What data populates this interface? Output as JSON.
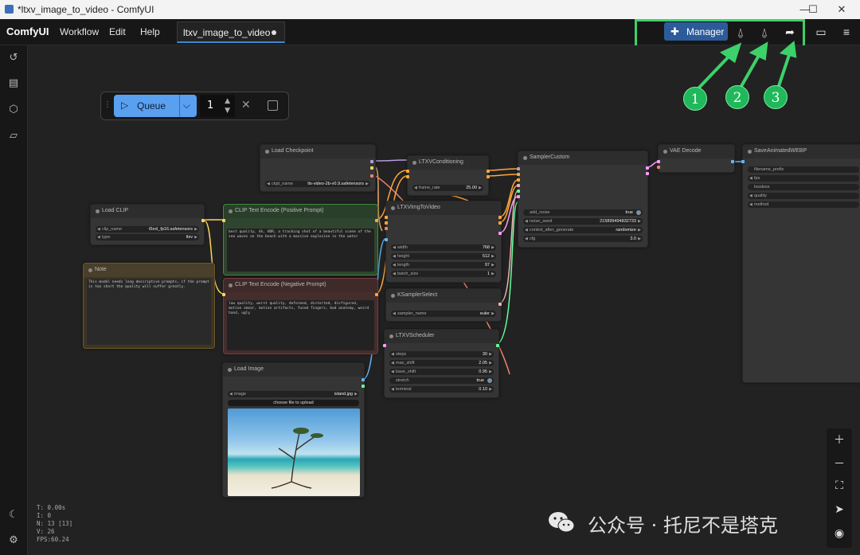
{
  "window": {
    "title": "*ltxv_image_to_video - ComfyUI",
    "min": "—",
    "max": "☐",
    "close": "✕"
  },
  "menubar": {
    "brand": "ComfyUI",
    "items": [
      "Workflow",
      "Edit",
      "Help"
    ],
    "tab": "ltxv_image_to_video",
    "manager": "Manager"
  },
  "queue": {
    "label": "Queue",
    "count": "1"
  },
  "nodes": {
    "load_checkpoint": {
      "title": "Load Checkpoint",
      "w_ckpt": "ckpt_name",
      "v_ckpt": "ltx-video-2b-v0.9.safetensors"
    },
    "ltxv_cond": {
      "title": "LTXVConditioning",
      "w_fr": "frame_rate",
      "v_fr": "25.00"
    },
    "sampler_custom": {
      "title": "SamplerCustom",
      "w1": "add_noise",
      "v1": "true",
      "w2": "noise_seed",
      "v2": "215899494832733",
      "w3": "control_after_generate",
      "v3": "randomize",
      "w4": "cfg",
      "v4": "3.0"
    },
    "vae_decode": {
      "title": "VAE Decode"
    },
    "save_webp": {
      "title": "SaveAnimatedWEBP",
      "w1": "filename_prefix",
      "w2": "fps",
      "w3": "lossless",
      "w4": "quality",
      "w5": "method"
    },
    "load_clip": {
      "title": "Load CLIP",
      "w1": "clip_name",
      "v1": "t5xxl_fp16.safetensors",
      "w2": "type",
      "v2": "ltxv"
    },
    "clip_pos": {
      "title": "CLIP Text Encode (Positive Prompt)",
      "text": "best quality, 4k, HDR, a tracking shot of a beautiful scene of the sea waves on the beach with a massive explosion in the water"
    },
    "clip_neg": {
      "title": "CLIP Text Encode (Negative Prompt)",
      "text": "low quality, worst quality, deformed, distorted, disfigured, motion smear, motion artifacts, fused fingers, bad anatomy, weird hand, ugly"
    },
    "note": {
      "title": "Note",
      "text": "This model needs long descriptive prompts, if the prompt is too short the quality will suffer greatly."
    },
    "ltxv_img": {
      "title": "LTXVImgToVideo",
      "w1": "width",
      "v1": "768",
      "w2": "height",
      "v2": "512",
      "w3": "length",
      "v3": "97",
      "w4": "batch_size",
      "v4": "1"
    },
    "ksampler_sel": {
      "title": "KSamplerSelect",
      "w1": "sampler_name",
      "v1": "euler"
    },
    "ltxv_sched": {
      "title": "LTXVScheduler",
      "w1": "steps",
      "v1": "30",
      "w2": "max_shift",
      "v2": "2.05",
      "w3": "base_shift",
      "v3": "0.95",
      "w4": "stretch",
      "v4": "true",
      "w5": "terminal",
      "v5": "0.10"
    },
    "load_image": {
      "title": "Load Image",
      "w1": "image",
      "v1": "island.jpg",
      "upload": "choose file to upload"
    }
  },
  "stats": {
    "t": "T: 0.00s",
    "i": "I: 0",
    "n": "N: 13 [13]",
    "v": "V: 26",
    "fps": "FPS:60.24"
  },
  "annotations": {
    "b1": "1",
    "b2": "2",
    "b3": "3"
  },
  "watermark": "公众号 · 托尼不是塔克",
  "colors": {
    "accent": "#3a88d6",
    "queue_button": "#5aa0f0",
    "highlight_green": "#3dd16a",
    "positive_node": "#2e4a2e",
    "negative_node": "#4a2d2d",
    "note_node": "#4a3f2a"
  }
}
